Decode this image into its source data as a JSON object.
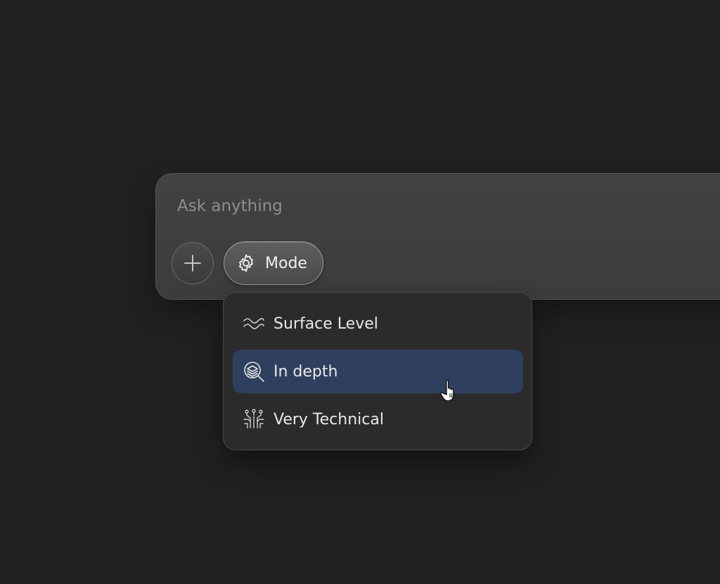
{
  "composer": {
    "placeholder": "Ask anything",
    "mode_label": "Mode"
  },
  "menu": {
    "items": [
      {
        "label": "Surface Level",
        "icon": "waves-icon"
      },
      {
        "label": "In depth",
        "icon": "layers-search-icon",
        "selected": true
      },
      {
        "label": "Very Technical",
        "icon": "circuit-icon"
      }
    ]
  },
  "colors": {
    "background": "#212121",
    "composer": "#404040",
    "menu": "#2b2b2b",
    "selected": "#2f405e",
    "text": "#e9e9e9",
    "placeholder": "#8e8e8e"
  }
}
